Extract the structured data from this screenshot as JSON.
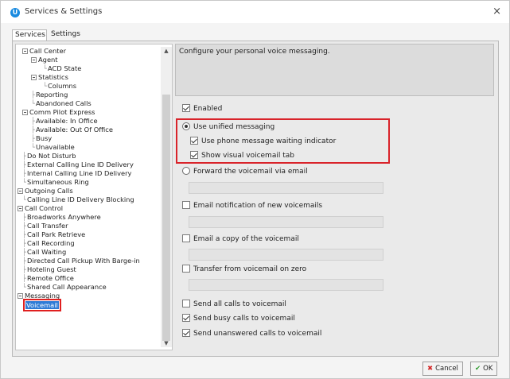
{
  "window": {
    "title": "Services & Settings",
    "close_glyph": "×"
  },
  "tabs": [
    {
      "label": "Services"
    },
    {
      "label": "Settings"
    }
  ],
  "tree": {
    "items": [
      {
        "label": "Call Center"
      },
      {
        "label": "Agent"
      },
      {
        "label": "ACD State"
      },
      {
        "label": "Statistics"
      },
      {
        "label": "Columns"
      },
      {
        "label": "Reporting"
      },
      {
        "label": "Abandoned Calls"
      },
      {
        "label": "Comm Pilot Express"
      },
      {
        "label": "Available: In Office"
      },
      {
        "label": "Available: Out Of Office"
      },
      {
        "label": "Busy"
      },
      {
        "label": "Unavailable"
      },
      {
        "label": "Do Not Disturb"
      },
      {
        "label": "External Calling Line ID Delivery"
      },
      {
        "label": "Internal Calling Line ID Delivery"
      },
      {
        "label": "Simultaneous Ring"
      },
      {
        "label": "Outgoing Calls"
      },
      {
        "label": "Calling Line ID Delivery Blocking"
      },
      {
        "label": "Call Control"
      },
      {
        "label": "Broadworks Anywhere"
      },
      {
        "label": "Call Transfer"
      },
      {
        "label": "Call Park Retrieve"
      },
      {
        "label": "Call Recording"
      },
      {
        "label": "Call Waiting"
      },
      {
        "label": "Directed Call Pickup With Barge-in"
      },
      {
        "label": "Hoteling Guest"
      },
      {
        "label": "Remote Office"
      },
      {
        "label": "Shared Call Appearance"
      },
      {
        "label": "Messaging"
      },
      {
        "label": "Voicemail"
      }
    ],
    "selected": "Voicemail"
  },
  "settings": {
    "description": "Configure your personal voice messaging.",
    "enabled": {
      "label": "Enabled",
      "checked": true
    },
    "use_unified": {
      "label": "Use unified messaging",
      "selected": true
    },
    "phone_indicator": {
      "label": "Use phone message waiting indicator",
      "checked": true
    },
    "visual_tab": {
      "label": "Show visual voicemail tab",
      "checked": true
    },
    "forward_email": {
      "label": "Forward the voicemail via email",
      "selected": false,
      "value": ""
    },
    "email_notification": {
      "label": "Email notification of new voicemails",
      "checked": false,
      "value": ""
    },
    "email_copy": {
      "label": "Email a copy of the voicemail",
      "checked": false,
      "value": ""
    },
    "transfer_zero": {
      "label": "Transfer from voicemail on zero",
      "checked": false,
      "value": ""
    },
    "send_all": {
      "label": "Send all calls to voicemail",
      "checked": false
    },
    "send_busy": {
      "label": "Send busy calls to voicemail",
      "checked": true
    },
    "send_unanswered": {
      "label": "Send unanswered calls to voicemail",
      "checked": true
    }
  },
  "buttons": {
    "cancel": "Cancel",
    "ok": "OK"
  },
  "colors": {
    "highlight": "#d9232a",
    "selection": "#2f7bd6"
  }
}
